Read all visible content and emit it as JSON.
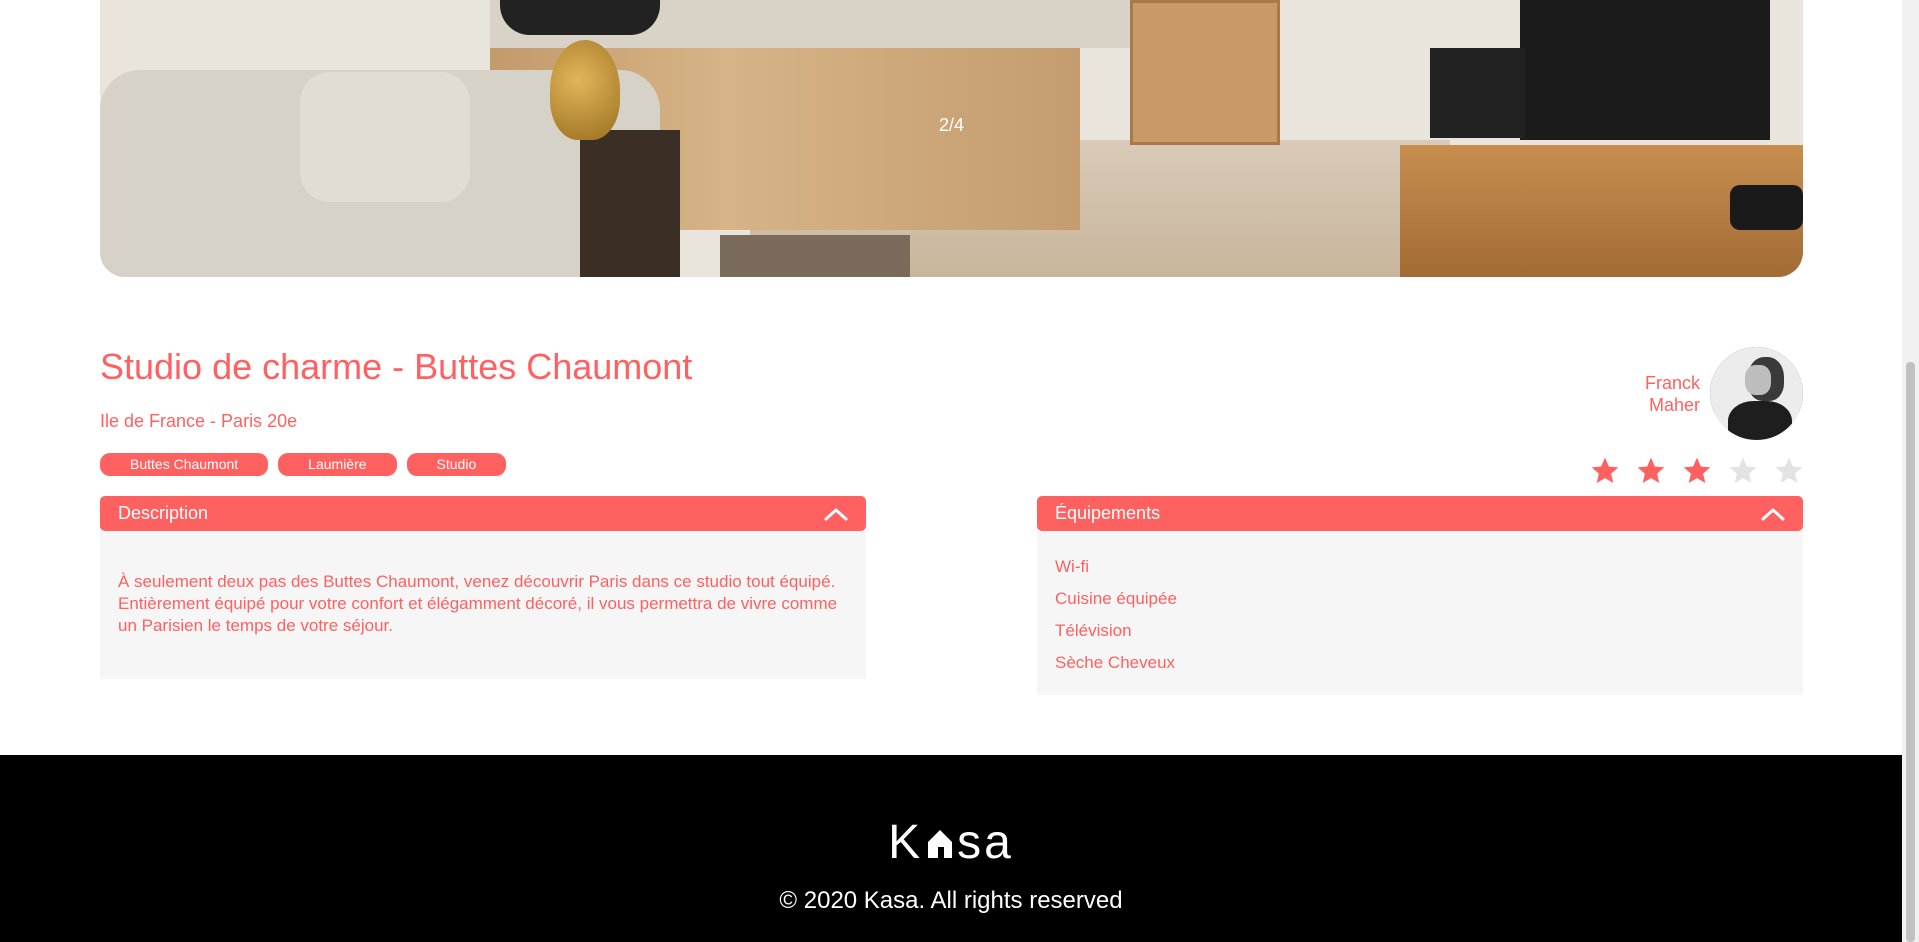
{
  "gallery": {
    "counter": "2/4"
  },
  "listing": {
    "title": "Studio de charme - Buttes Chaumont",
    "location": "Ile de France - Paris 20e",
    "tags": [
      "Buttes Chaumont",
      "Laumière",
      "Studio"
    ],
    "host": {
      "first_name": "Franck",
      "last_name": "Maher"
    },
    "rating": 3,
    "rating_max": 5
  },
  "description": {
    "title": "Description",
    "text": "À seulement deux pas des Buttes Chaumont, venez découvrir Paris dans ce studio tout équipé. Entièrement équipé pour votre confort et élégamment décoré, il vous permettra de vivre comme un Parisien le temps de votre séjour."
  },
  "equipments": {
    "title": "Équipements",
    "items": [
      "Wi-fi",
      "Cuisine équipée",
      "Télévision",
      "Sèche Cheveux"
    ]
  },
  "footer": {
    "logo_left": "K",
    "logo_right": "sa",
    "copyright": "© 2020 Kasa. All rights reserved"
  },
  "colors": {
    "accent": "#ff6060",
    "star_inactive": "#e3e3e3",
    "panel_bg": "#f6f6f6",
    "footer_bg": "#000000"
  }
}
